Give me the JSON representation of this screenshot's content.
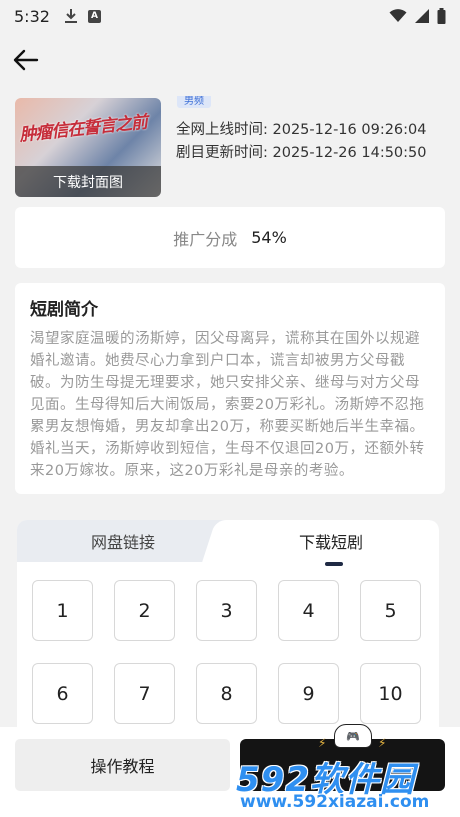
{
  "status": {
    "time": "5:32",
    "app_badge": "A"
  },
  "cover": {
    "title_art": "肿瘤信在誓言之前",
    "download_label": "下载封面图"
  },
  "tag": "男频",
  "meta": {
    "online_time": "全网上线时间: 2025-12-16 09:26:04",
    "update_time": "剧目更新时间: 2025-12-26 14:50:50"
  },
  "share": {
    "label": "推广分成",
    "value": "54%"
  },
  "intro": {
    "title": "短剧简介",
    "text": "渴望家庭温暖的汤斯婷，因父母离异，谎称其在国外以规避婚礼邀请。她费尽心力拿到户口本，谎言却被男方父母戳破。为防生母提无理要求，她只安排父亲、继母与对方父母见面。生母得知后大闹饭局，索要20万彩礼。汤斯婷不忍拖累男友想悔婚，男友却拿出20万，称要买断她后半生幸福。婚礼当天，汤斯婷收到短信，生母不仅退回20万，还额外转来20万嫁妆。原来，这20万彩礼是母亲的考验。"
  },
  "tabs": {
    "left": "网盘链接",
    "right": "下载短剧"
  },
  "episodes": [
    "1",
    "2",
    "3",
    "4",
    "5",
    "6",
    "7",
    "8",
    "9",
    "10"
  ],
  "bottom": {
    "tutorial_label": "操作教程"
  },
  "watermark": {
    "brand": "592软件园",
    "url": "www.592xiazai.com"
  },
  "colors": {
    "accent": "#2f8ff0",
    "tab_indicator": "#1f2a44",
    "background": "#f2f2f2"
  },
  "icons": [
    "download-icon",
    "wifi-icon",
    "signal-icon",
    "battery-icon",
    "back-arrow-icon"
  ]
}
